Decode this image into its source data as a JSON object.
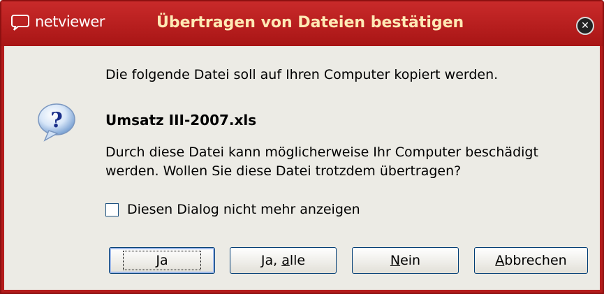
{
  "titlebar": {
    "app_name": "netviewer",
    "title": "Übertragen von Dateien bestätigen",
    "close_icon": "close-icon"
  },
  "dialog": {
    "icon": "question-icon",
    "message": "Die folgende Datei soll auf Ihren Computer kopiert werden.",
    "filename": "Umsatz III-2007.xls",
    "warning_line1": "Durch diese Datei kann möglicherweise Ihr Computer beschädigt",
    "warning_line2": "werden. Wollen Sie diese Datei trotzdem übertragen?",
    "checkbox_label": "Diesen Dialog nicht mehr anzeigen",
    "checkbox_checked": false
  },
  "buttons": {
    "ja_prefix": "",
    "ja_mnemonic": "J",
    "ja_suffix": "a",
    "jaalle_prefix": "Ja, ",
    "jaalle_mnemonic": "a",
    "jaalle_suffix": "lle",
    "nein_prefix": "",
    "nein_mnemonic": "N",
    "nein_suffix": "ein",
    "abbrechen_prefix": "",
    "abbrechen_mnemonic": "A",
    "abbrechen_suffix": "bbrechen"
  },
  "colors": {
    "titlebar": "#b41c1c",
    "title_text": "#ffe9b5",
    "client_bg": "#ecebe5",
    "button_border": "#003c74"
  }
}
